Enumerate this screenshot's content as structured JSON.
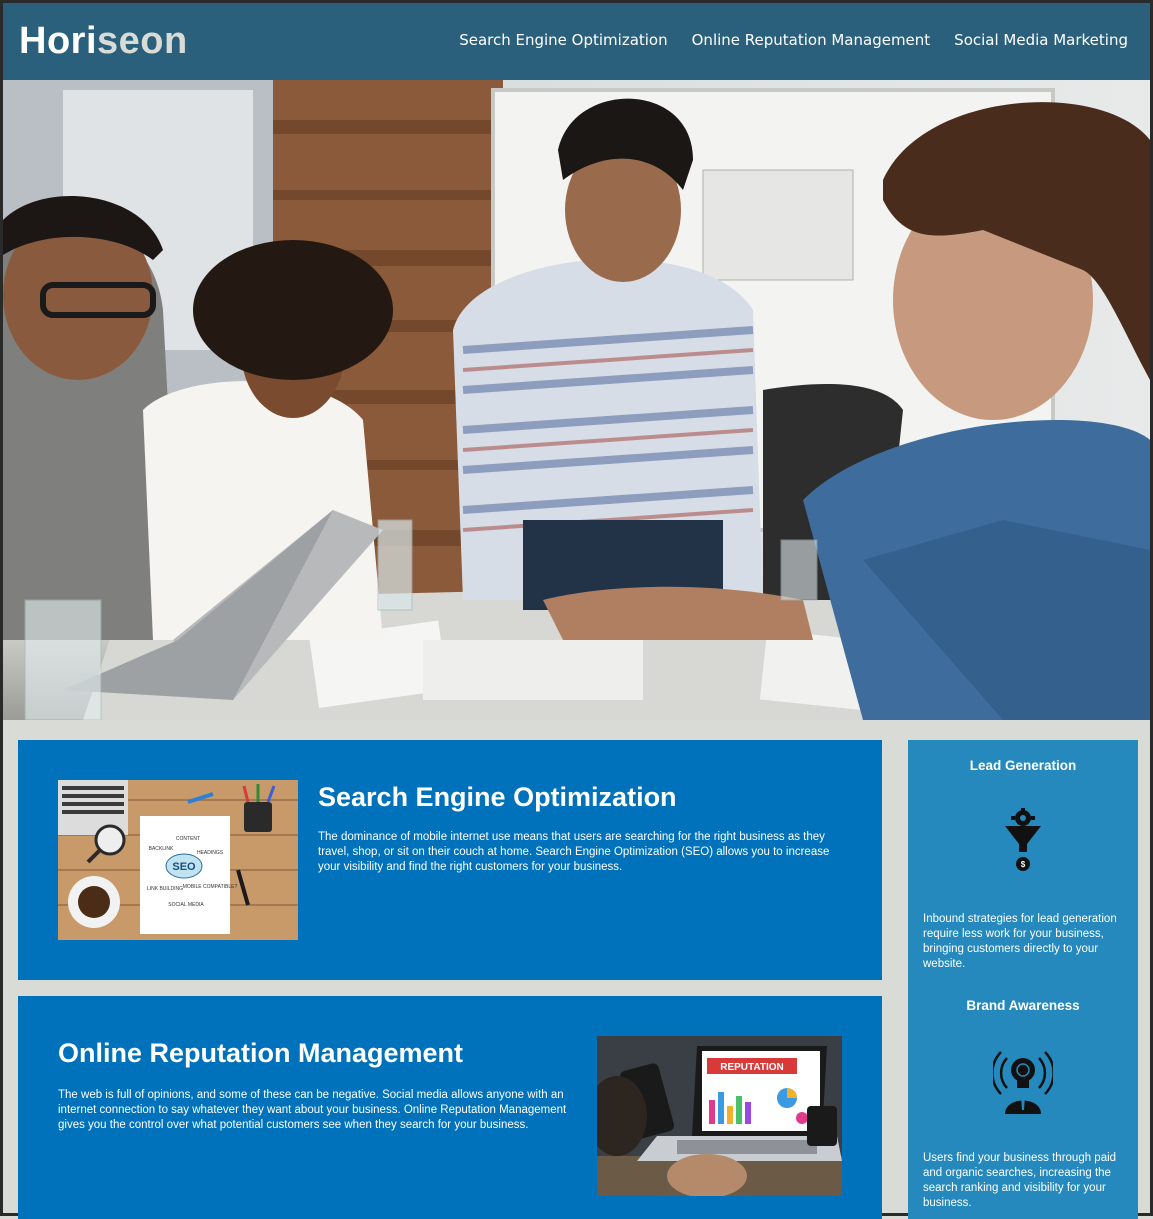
{
  "header": {
    "logo_main": "Hori",
    "logo_accent": "seon",
    "nav": [
      {
        "label": "Search Engine Optimization"
      },
      {
        "label": "Online Reputation Management"
      },
      {
        "label": "Social Media Marketing"
      }
    ]
  },
  "hero": {
    "image": "business-team-meeting-photo"
  },
  "content": [
    {
      "title": "Search Engine Optimization",
      "text": "The dominance of mobile internet use means that users are searching for the right business as they travel, shop, or sit on their couch at home. Search Engine Optimization (SEO) allows you to increase your visibility and find the right customers for your business.",
      "image": "seo-notebook-image",
      "image_words": [
        "SEO",
        "CONTENT",
        "BACKLINK",
        "HEADINGS",
        "LINK BUILDING",
        "MOBILE COMPATIBLE?",
        "SOCIAL MEDIA"
      ]
    },
    {
      "title": "Online Reputation Management",
      "text": "The web is full of opinions, and some of these can be negative. Social media allows anyone with an internet connection to say whatever they want about your business. Online Reputation Management gives you the control over what potential customers see when they search for your business.",
      "image": "reputation-laptop-image",
      "image_words": [
        "REPUTATION"
      ]
    }
  ],
  "sidebar": [
    {
      "title": "Lead Generation",
      "icon": "lead-generation-icon",
      "text": "Inbound strategies for lead generation require less work for your business, bringing customers directly to your website."
    },
    {
      "title": "Brand Awareness",
      "icon": "brand-awareness-icon",
      "text": "Users find your business through paid and organic searches, increasing the search ranking and visibility for your business."
    }
  ],
  "colors": {
    "header": "#2a607c",
    "page_bg": "#d9dcd6",
    "content_card": "#0072bb",
    "sidebar": "#2589bd"
  }
}
